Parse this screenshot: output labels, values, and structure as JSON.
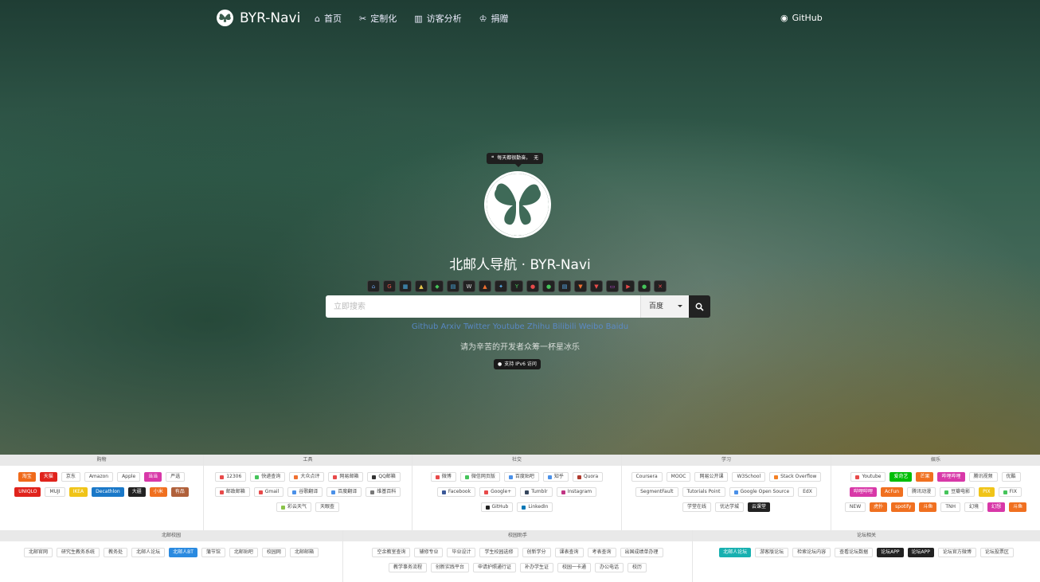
{
  "nav": {
    "brand": "BYR-Navi",
    "links": [
      {
        "label": "首页",
        "icon": "home-icon",
        "glyph": "⌂"
      },
      {
        "label": "定制化",
        "icon": "tools-icon",
        "glyph": "✂"
      },
      {
        "label": "访客分析",
        "icon": "chart-icon",
        "glyph": "▥"
      },
      {
        "label": "捐赠",
        "icon": "donate-icon",
        "glyph": "♔"
      }
    ],
    "github": "GitHub"
  },
  "hero": {
    "quote": "每天都很勤奋。",
    "quote_author": "无",
    "title": "北邮人导航 · BYR-Navi",
    "search_placeholder": "立即搜索",
    "engine": "百度",
    "quick_links": "Github Arxiv Twitter Youtube Zhihu Bilibili Weibo Baidu",
    "donate_text": "请为辛苦的开发者众筹一杯星冰乐",
    "ipv6": "支持 IPv6 访问"
  },
  "engines": [
    {
      "g": "⌂",
      "c": "#6aa0e8"
    },
    {
      "g": "G",
      "c": "#e8584a"
    },
    {
      "g": "▦",
      "c": "#4ab0e8"
    },
    {
      "g": "▲",
      "c": "#e8c84a"
    },
    {
      "g": "◆",
      "c": "#45c45a"
    },
    {
      "g": "▤",
      "c": "#4ab0e8"
    },
    {
      "g": "W",
      "c": "#ddd"
    },
    {
      "g": "▲",
      "c": "#f07030"
    },
    {
      "g": "✦",
      "c": "#5ab0f0"
    },
    {
      "g": "Y",
      "c": "#45c45a"
    },
    {
      "g": "●",
      "c": "#e84a4a"
    },
    {
      "g": "●",
      "c": "#45c45a"
    },
    {
      "g": "▤",
      "c": "#5ab0f0"
    },
    {
      "g": "▼",
      "c": "#f07030"
    },
    {
      "g": "▼",
      "c": "#e84a4a"
    },
    {
      "g": "▭",
      "c": "#c04ad8"
    },
    {
      "g": "▶",
      "c": "#e84a4a"
    },
    {
      "g": "●",
      "c": "#45c45a"
    },
    {
      "g": "✕",
      "c": "#e84a4a"
    }
  ],
  "panels_row1": [
    {
      "title": "购物",
      "width": 256,
      "items": [
        {
          "label": "淘宝",
          "bg": "#f06a1a"
        },
        {
          "label": "天猫",
          "bg": "#e0231c"
        },
        {
          "label": "京东"
        },
        {
          "label": "Amazon"
        },
        {
          "label": "Apple"
        },
        {
          "label": "当当",
          "bg": "#d838a8"
        },
        {
          "label": "严选"
        },
        {
          "label": "UNIQLO",
          "bg": "#e0231c"
        },
        {
          "label": "MUJI"
        },
        {
          "label": "IKEA",
          "bg": "#f0c418"
        },
        {
          "label": "Decathlon",
          "bg": "#1a78c8"
        },
        {
          "label": "大疆",
          "bg": "#222"
        },
        {
          "label": "小米",
          "bg": "#f07020"
        },
        {
          "label": "有品",
          "bg": "#b0603a"
        }
      ]
    },
    {
      "title": "工具",
      "width": 262,
      "items": [
        {
          "label": "12306",
          "dot": "#e84a4a"
        },
        {
          "label": "快递查询",
          "dot": "#45c45a"
        },
        {
          "label": "大众点评",
          "dot": "#f07030"
        },
        {
          "label": "网易邮箱",
          "dot": "#e84a4a"
        },
        {
          "label": "QQ邮箱",
          "dot": "#333"
        },
        {
          "label": "邮政邮箱",
          "dot": "#e84a4a"
        },
        {
          "label": "Gmail",
          "dot": "#e84a4a"
        },
        {
          "label": "谷歌翻译",
          "dot": "#4a90e8"
        },
        {
          "label": "百度翻译",
          "dot": "#4a90e8"
        },
        {
          "label": "维基百科",
          "dot": "#777"
        },
        {
          "label": "彩云天气",
          "dot": "#8ac34a"
        },
        {
          "label": "天眼查"
        }
      ]
    },
    {
      "title": "社交",
      "width": 263,
      "items": [
        {
          "label": "微博",
          "dot": "#e84a4a"
        },
        {
          "label": "微信网页版",
          "dot": "#45c45a"
        },
        {
          "label": "百度贴吧",
          "dot": "#4a90e8"
        },
        {
          "label": "知乎",
          "dot": "#4a90e8"
        },
        {
          "label": "Quora",
          "dot": "#b03a2e"
        },
        {
          "label": "Facebook",
          "dot": "#3b5998"
        },
        {
          "label": "Google+",
          "dot": "#e84a4a"
        },
        {
          "label": "Tumblr",
          "dot": "#36465d"
        },
        {
          "label": "Instagram",
          "dot": "#c13584"
        },
        {
          "label": "GitHub",
          "dot": "#222"
        },
        {
          "label": "LinkedIn",
          "dot": "#0077b5"
        }
      ]
    },
    {
      "title": "学习",
      "width": 263,
      "items": [
        {
          "label": "Coursera"
        },
        {
          "label": "MOOC"
        },
        {
          "label": "网易公开课"
        },
        {
          "label": "W3School"
        },
        {
          "label": "Stack Overflow",
          "dot": "#f48024"
        },
        {
          "label": "SegmentFault"
        },
        {
          "label": "Tutorials Point"
        },
        {
          "label": "Google Open Source",
          "dot": "#4a90e8"
        },
        {
          "label": "EdX"
        },
        {
          "label": "学堂在线"
        },
        {
          "label": "优达学城"
        },
        {
          "label": "云课堂",
          "bg": "#222"
        }
      ]
    },
    {
      "title": "娱乐",
      "width": 262,
      "items": [
        {
          "label": "Youtube",
          "dot": "#e84a4a"
        },
        {
          "label": "爱奇艺",
          "bg": "#00be06"
        },
        {
          "label": "芒果",
          "bg": "#f07020"
        },
        {
          "label": "哔哩哔哩",
          "bg": "#d838a8"
        },
        {
          "label": "腾讯视频"
        },
        {
          "label": "优酷"
        },
        {
          "label": "哔哩哔哩",
          "bg": "#d838a8"
        },
        {
          "label": "AcFun",
          "bg": "#f07020"
        },
        {
          "label": "腾讯动漫"
        },
        {
          "label": "豆瓣电影",
          "dot": "#45c45a"
        },
        {
          "label": "PIX",
          "bg": "#f0c418"
        },
        {
          "label": "FIX",
          "dot": "#45c45a"
        },
        {
          "label": "NEW"
        },
        {
          "label": "虎扑",
          "bg": "#f07020"
        },
        {
          "label": "spotify",
          "bg": "#f07020"
        },
        {
          "label": "斗鱼",
          "bg": "#f07020"
        },
        {
          "label": "TNH"
        },
        {
          "label": "幻境"
        },
        {
          "label": "幻想",
          "bg": "#d838a8"
        },
        {
          "label": "斗鱼",
          "bg": "#f07020"
        }
      ]
    }
  ],
  "panels_row2": [
    {
      "title": "北邮校园",
      "width": 431,
      "items": [
        {
          "label": "北邮官网"
        },
        {
          "label": "研究生教务系统"
        },
        {
          "label": "教务处"
        },
        {
          "label": "北邮人论坛"
        },
        {
          "label": "北邮人BT",
          "bg": "#2a8ae0"
        },
        {
          "label": "蒲节馆"
        },
        {
          "label": "北邮贴吧"
        },
        {
          "label": "校园网"
        },
        {
          "label": "北邮邮箱"
        }
      ]
    },
    {
      "title": "校园助手",
      "width": 439,
      "items": [
        {
          "label": "空余教室查询"
        },
        {
          "label": "辅修专业"
        },
        {
          "label": "毕业设计"
        },
        {
          "label": "学生校园选修"
        },
        {
          "label": "创新学分"
        },
        {
          "label": "课表查询"
        },
        {
          "label": "考表查询"
        },
        {
          "label": "出国成绩单办理"
        },
        {
          "label": "教学事务流程"
        },
        {
          "label": "创新实践平台"
        },
        {
          "label": "申请护照通行证"
        },
        {
          "label": "补办学生证"
        },
        {
          "label": "校园一卡通"
        },
        {
          "label": "办公电话"
        },
        {
          "label": "校历"
        }
      ]
    },
    {
      "title": "论坛相关",
      "width": 436,
      "items": [
        {
          "label": "北邮人论坛",
          "bg": "#18b0b0"
        },
        {
          "label": "游客版论坛"
        },
        {
          "label": "检索论坛内容"
        },
        {
          "label": "查看论坛数据"
        },
        {
          "label": "论坛APP",
          "bg": "#222"
        },
        {
          "label": "论坛APP",
          "bg": "#222"
        },
        {
          "label": "论坛官方微博"
        },
        {
          "label": "论坛投票区"
        }
      ]
    }
  ]
}
